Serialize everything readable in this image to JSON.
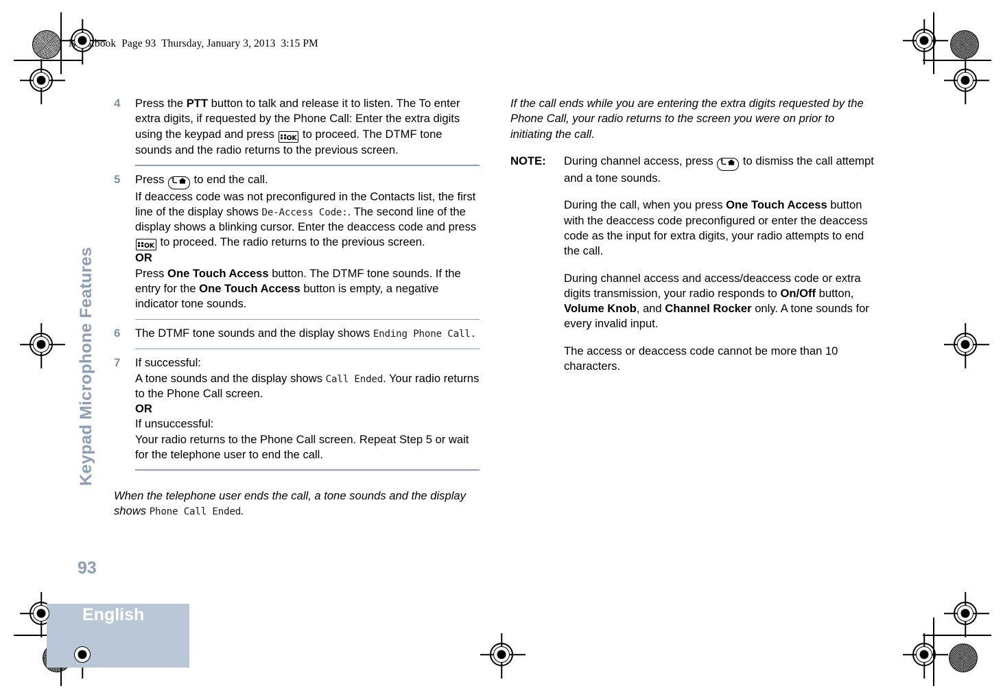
{
  "header": {
    "slug": "NAG.book  Page 93  Thursday, January 3, 2013  3:15 PM"
  },
  "sidebar": {
    "chapter_title": "Keypad Microphone Features",
    "page_number": "93",
    "language": "English",
    "accent_color": "#8a9eb5",
    "language_box_color": "#b9c7d6"
  },
  "icons": {
    "ok_key": "ok-key-icon",
    "ok_key_label": "OK",
    "back_home_key": "back-home-key-icon"
  },
  "left_column": {
    "steps": [
      {
        "number": "4",
        "lines": [
          {
            "type": "text",
            "parts": [
              {
                "t": "Press the "
              },
              {
                "t": "PTT",
                "s": "bold"
              },
              {
                "t": " button to talk and release it to listen. The To enter extra digits, if requested by the Phone Call: Enter the extra digits using the keypad and press "
              },
              {
                "t": "",
                "s": "key-ok"
              },
              {
                "t": " to proceed. The DTMF tone sounds and the radio returns to the previous screen."
              }
            ]
          }
        ]
      },
      {
        "number": "5",
        "lines": [
          {
            "type": "text",
            "parts": [
              {
                "t": "Press "
              },
              {
                "t": "",
                "s": "key-back"
              },
              {
                "t": " to end the call."
              }
            ]
          },
          {
            "type": "text",
            "parts": [
              {
                "t": "If deaccess code was not preconfigured in the Contacts list, the first line of the display shows "
              },
              {
                "t": "De-Access Code:",
                "s": "disp"
              },
              {
                "t": ". The second line of the display shows a blinking cursor. Enter the deaccess code and press "
              },
              {
                "t": "",
                "s": "key-ok"
              },
              {
                "t": " to proceed. The radio returns to the previous screen."
              }
            ]
          },
          {
            "type": "text",
            "parts": [
              {
                "t": "OR",
                "s": "bold"
              }
            ]
          },
          {
            "type": "text",
            "parts": [
              {
                "t": "Press "
              },
              {
                "t": "One Touch Access",
                "s": "bold"
              },
              {
                "t": " button. The DTMF tone sounds. If the entry for the "
              },
              {
                "t": "One Touch Access",
                "s": "bold"
              },
              {
                "t": " button is empty, a negative indicator tone sounds."
              }
            ]
          }
        ]
      },
      {
        "number": "6",
        "lines": [
          {
            "type": "text",
            "parts": [
              {
                "t": "The DTMF tone sounds and the display shows "
              },
              {
                "t": "Ending Phone Call.",
                "s": "disp"
              }
            ]
          }
        ]
      },
      {
        "number": "7",
        "lines": [
          {
            "type": "text",
            "parts": [
              {
                "t": "If successful:"
              }
            ]
          },
          {
            "type": "text",
            "parts": [
              {
                "t": "A tone sounds and the display shows "
              },
              {
                "t": "Call Ended",
                "s": "disp"
              },
              {
                "t": ". Your radio returns to the Phone Call screen."
              }
            ]
          },
          {
            "type": "text",
            "parts": [
              {
                "t": "OR",
                "s": "bold"
              }
            ]
          },
          {
            "type": "text",
            "parts": [
              {
                "t": "If unsuccessful:"
              }
            ]
          },
          {
            "type": "text",
            "parts": [
              {
                "t": "Your radio returns to the Phone Call screen. Repeat Step 5 or wait for the telephone user to end the call."
              }
            ]
          }
        ]
      }
    ],
    "closing_note": {
      "italic_lead": "When the telephone user ends the call, a tone sounds and the display shows ",
      "display_text": "Phone Call Ended",
      "trailing": "."
    }
  },
  "right_column": {
    "intro_italic": "If the call ends while you are entering the extra digits requested by the Phone Call, your radio returns to the screen you were on prior to initiating the call.",
    "note_label": "NOTE:",
    "note_paragraphs": [
      {
        "parts": [
          {
            "t": "During channel access, press "
          },
          {
            "t": "",
            "s": "key-back"
          },
          {
            "t": " to dismiss the call attempt and a tone sounds."
          }
        ]
      },
      {
        "parts": [
          {
            "t": "During the call, when you press "
          },
          {
            "t": "One Touch Access",
            "s": "bold"
          },
          {
            "t": " button with the deaccess code preconfigured or enter the deaccess code as the input for extra digits, your radio attempts to end the call."
          }
        ]
      },
      {
        "parts": [
          {
            "t": "During channel access and access/deaccess code or extra digits transmission, your radio responds to "
          },
          {
            "t": "On/Off",
            "s": "bold"
          },
          {
            "t": " button, "
          },
          {
            "t": "Volume Knob",
            "s": "bold"
          },
          {
            "t": ", and "
          },
          {
            "t": "Channel Rocker",
            "s": "bold"
          },
          {
            "t": " only. A tone sounds for every invalid input."
          }
        ]
      },
      {
        "parts": [
          {
            "t": "The access or deaccess code cannot be more than 10 characters."
          }
        ]
      }
    ]
  }
}
